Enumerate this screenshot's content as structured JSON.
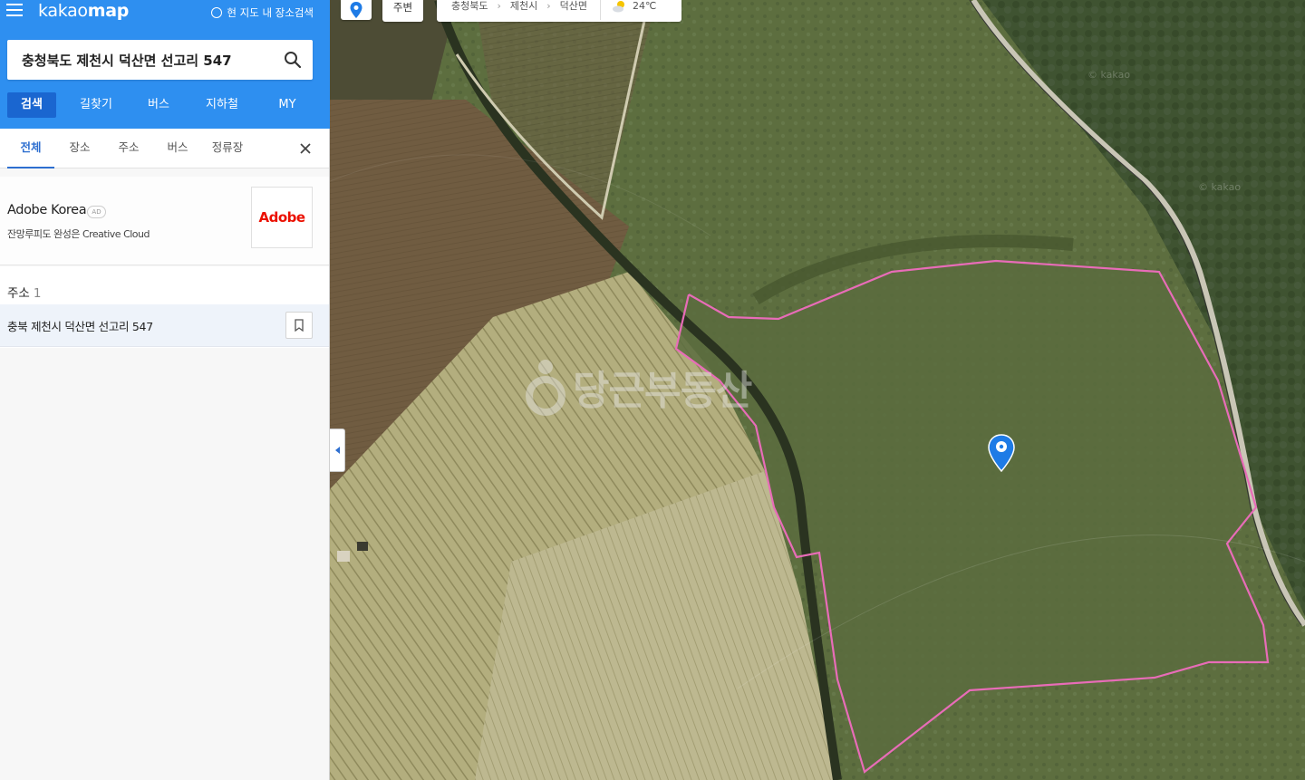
{
  "header": {
    "logo_plain": "kakao",
    "logo_bold": "map",
    "area_search_label": "현 지도 내 장소검색"
  },
  "search": {
    "query": "충청북도 제천시 덕산면 선고리 547"
  },
  "main_tabs": [
    {
      "label": "검색",
      "active": true
    },
    {
      "label": "길찾기",
      "active": false
    },
    {
      "label": "버스",
      "active": false
    },
    {
      "label": "지하철",
      "active": false
    },
    {
      "label": "MY",
      "active": false
    }
  ],
  "sub_tabs": [
    {
      "label": "전체",
      "active": true
    },
    {
      "label": "장소",
      "active": false
    },
    {
      "label": "주소",
      "active": false
    },
    {
      "label": "버스",
      "active": false
    },
    {
      "label": "정류장",
      "active": false
    }
  ],
  "ad": {
    "title": "Adobe Korea",
    "badge": "AD",
    "description": "잔망루피도 완성은 Creative Cloud",
    "logo_text": "Adobe"
  },
  "results": {
    "heading": "주소",
    "count": "1",
    "items": [
      {
        "address": "충북 제천시 덕산면 선고리 547"
      }
    ]
  },
  "map_toolbar": {
    "pin_icon": "map-pin-icon",
    "nearby_label": "주변",
    "breadcrumb": [
      "충청북도",
      "제천시",
      "덕산면"
    ],
    "weather_icon": "partly-cloudy-icon",
    "temperature": "24℃"
  },
  "map": {
    "watermark_text": "당근부동산",
    "tile_watermark": "© kakao",
    "parcel_border_color": "#e86cb8",
    "marker_color": "#1e7be6"
  },
  "colors": {
    "header_blue": "#2e8ff0",
    "active_tab_blue": "#1a66d0",
    "sub_tab_active": "#2e6fd0",
    "adobe_red": "#eb1000"
  }
}
